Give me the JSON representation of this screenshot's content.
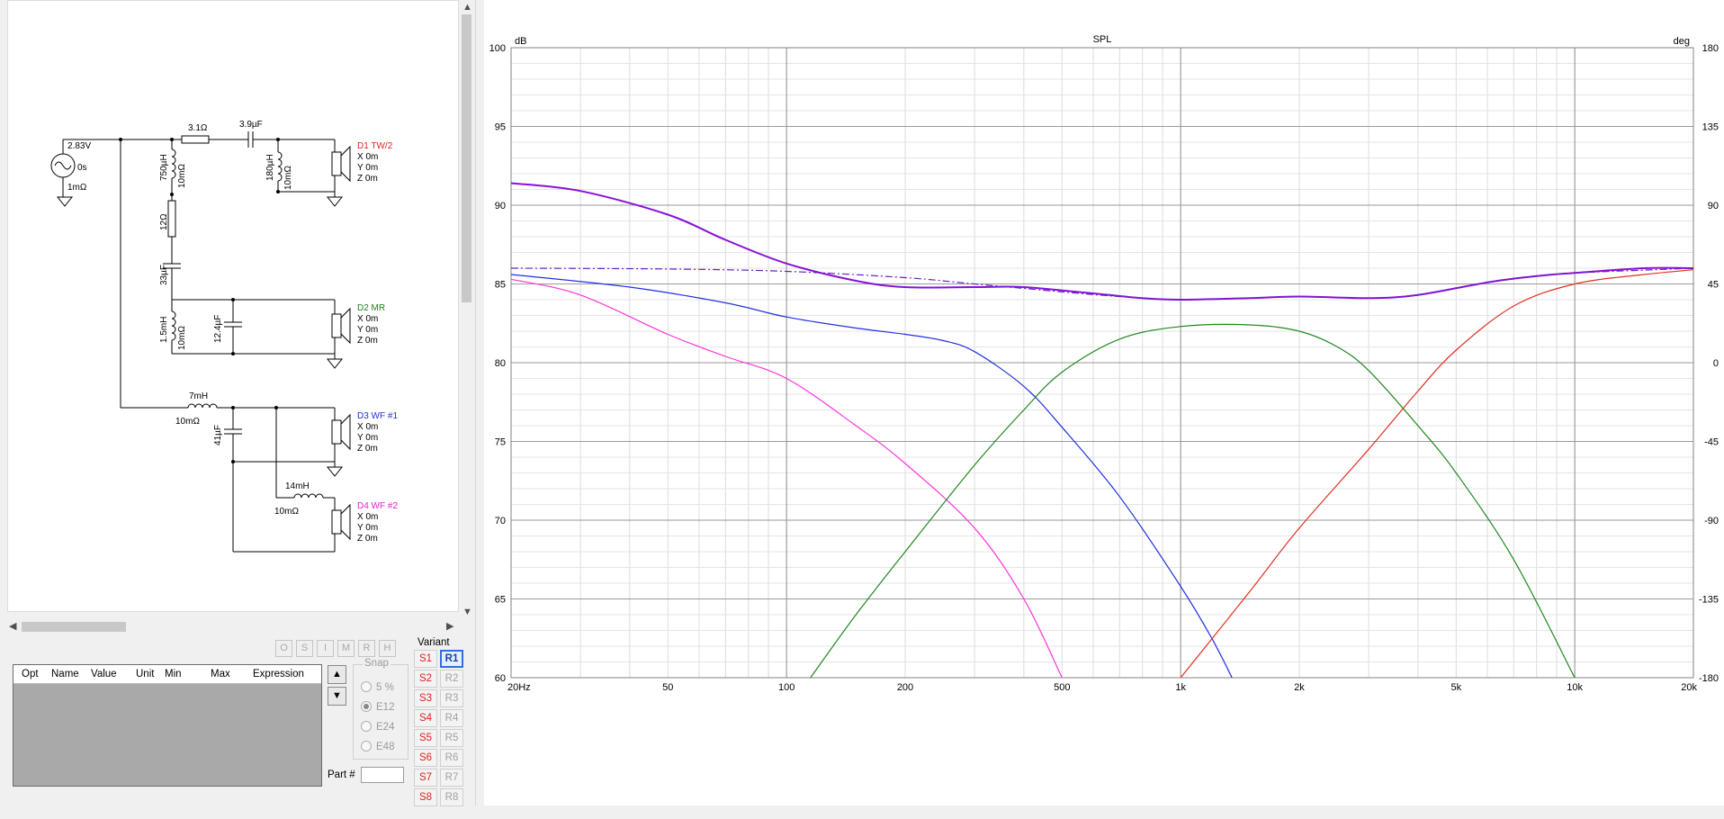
{
  "schematic": {
    "source": {
      "voltage": "2.83V",
      "delay": "0s",
      "resistance": "1mΩ"
    },
    "components": {
      "r_series_tw": "3.1Ω",
      "c_series_tw": "3.9µF",
      "l_shunt_main": "750µH",
      "l_shunt_main_r": "10mΩ",
      "l_shunt_tw": "180µH",
      "l_shunt_tw_r": "10mΩ",
      "r_mr": "12Ω",
      "c_mr": "33µF",
      "l_mr": "1.5mH",
      "l_mr_r": "10mΩ",
      "c_mr_shunt": "12.4µF",
      "l_wf1": "7mH",
      "l_wf1_r": "10mΩ",
      "c_wf1": "41µF",
      "l_wf2": "14mH",
      "l_wf2_r": "10mΩ"
    },
    "drivers": [
      {
        "name": "D1 TW/2",
        "color": "#e02020",
        "x": "X 0m",
        "y": "Y 0m",
        "z": "Z 0m"
      },
      {
        "name": "D2 MR",
        "color": "#208020",
        "x": "X 0m",
        "y": "Y 0m",
        "z": "Z 0m"
      },
      {
        "name": "D3 WF #1",
        "color": "#2030d0",
        "x": "X 0m",
        "y": "Y 0m",
        "z": "Z 0m"
      },
      {
        "name": "D4 WF #2",
        "color": "#e020d0",
        "x": "X 0m",
        "y": "Y 0m",
        "z": "Z 0m"
      }
    ]
  },
  "toolbar_buttons": [
    "O",
    "S",
    "I",
    "M",
    "R",
    "H"
  ],
  "param_table": {
    "columns": [
      "Opt",
      "Name",
      "Value",
      "Unit",
      "Min",
      "Max",
      "Expression"
    ]
  },
  "snap": {
    "title": "Snap",
    "options": [
      "5 %",
      "E12",
      "E24",
      "E48"
    ],
    "selected": "E12"
  },
  "part_label": "Part #",
  "variant": {
    "label": "Variant",
    "s_buttons": [
      "S1",
      "S2",
      "S3",
      "S4",
      "S5",
      "S6",
      "S7",
      "S8"
    ],
    "r_buttons": [
      "R1",
      "R2",
      "R3",
      "R4",
      "R5",
      "R6",
      "R7",
      "R8"
    ],
    "active": "R1"
  },
  "chart_data": {
    "type": "line",
    "title": "SPL",
    "ylabel": "dB",
    "y2label": "deg",
    "xscale": "log",
    "xlim": [
      20,
      20000
    ],
    "ylim": [
      60,
      100
    ],
    "y2lim": [
      -180,
      180
    ],
    "x_ticks": [
      {
        "v": 20,
        "label": "20Hz"
      },
      {
        "v": 50,
        "label": "50"
      },
      {
        "v": 100,
        "label": "100"
      },
      {
        "v": 200,
        "label": "200"
      },
      {
        "v": 500,
        "label": "500"
      },
      {
        "v": 1000,
        "label": "1k"
      },
      {
        "v": 2000,
        "label": "2k"
      },
      {
        "v": 5000,
        "label": "5k"
      },
      {
        "v": 10000,
        "label": "10k"
      },
      {
        "v": 20000,
        "label": "20k"
      }
    ],
    "y_ticks": [
      100,
      95,
      90,
      85,
      80,
      75,
      70,
      65,
      60
    ],
    "y2_ticks": [
      180,
      135,
      90,
      45,
      0,
      -45,
      -90,
      -135,
      -180
    ],
    "grid": true,
    "series": [
      {
        "color": "#8a10d8",
        "width": 2,
        "dash": "",
        "points": [
          [
            20,
            91.4
          ],
          [
            30,
            90.9
          ],
          [
            50,
            89.4
          ],
          [
            70,
            87.8
          ],
          [
            100,
            86.3
          ],
          [
            150,
            85.2
          ],
          [
            200,
            84.8
          ],
          [
            300,
            84.8
          ],
          [
            400,
            84.8
          ],
          [
            600,
            84.4
          ],
          [
            800,
            84.1
          ],
          [
            1000,
            84.0
          ],
          [
            1500,
            84.1
          ],
          [
            2000,
            84.2
          ],
          [
            3000,
            84.1
          ],
          [
            4000,
            84.3
          ],
          [
            6000,
            85.1
          ],
          [
            8000,
            85.5
          ],
          [
            10000,
            85.7
          ],
          [
            15000,
            86.0
          ],
          [
            20000,
            86.0
          ]
        ]
      },
      {
        "color": "#6a20c0",
        "width": 1.2,
        "dash": "8,3,2,3",
        "points": [
          [
            20,
            86.0
          ],
          [
            50,
            85.95
          ],
          [
            100,
            85.8
          ],
          [
            200,
            85.4
          ],
          [
            300,
            85.0
          ],
          [
            500,
            84.5
          ],
          [
            700,
            84.2
          ],
          [
            1000,
            84.0
          ],
          [
            1500,
            84.1
          ],
          [
            2000,
            84.2
          ],
          [
            3000,
            84.1
          ],
          [
            4000,
            84.3
          ],
          [
            6000,
            85.1
          ],
          [
            8000,
            85.5
          ],
          [
            10000,
            85.7
          ],
          [
            20000,
            86.0
          ]
        ]
      },
      {
        "color": "#2030e0",
        "width": 1.2,
        "dash": "",
        "points": [
          [
            20,
            85.6
          ],
          [
            40,
            84.8
          ],
          [
            70,
            83.8
          ],
          [
            100,
            82.9
          ],
          [
            150,
            82.2
          ],
          [
            200,
            81.8
          ],
          [
            250,
            81.4
          ],
          [
            300,
            80.7
          ],
          [
            400,
            78.5
          ],
          [
            500,
            75.9
          ],
          [
            700,
            71.5
          ],
          [
            1000,
            65.8
          ],
          [
            1200,
            62.5
          ],
          [
            1350,
            60.0
          ]
        ]
      },
      {
        "color": "#ff33dd",
        "width": 1.2,
        "dash": "",
        "points": [
          [
            20,
            85.3
          ],
          [
            30,
            84.3
          ],
          [
            50,
            81.8
          ],
          [
            70,
            80.4
          ],
          [
            100,
            79.0
          ],
          [
            150,
            76.0
          ],
          [
            200,
            73.6
          ],
          [
            300,
            69.5
          ],
          [
            400,
            65.0
          ],
          [
            500,
            60.0
          ]
        ]
      },
      {
        "color": "#208820",
        "width": 1.2,
        "dash": "",
        "points": [
          [
            115,
            60.0
          ],
          [
            150,
            64.0
          ],
          [
            200,
            68.0
          ],
          [
            300,
            73.5
          ],
          [
            400,
            77.0
          ],
          [
            500,
            79.4
          ],
          [
            700,
            81.5
          ],
          [
            1000,
            82.3
          ],
          [
            1500,
            82.4
          ],
          [
            2000,
            82.0
          ],
          [
            2500,
            81.0
          ],
          [
            3000,
            79.5
          ],
          [
            4000,
            76.0
          ],
          [
            5000,
            73.0
          ],
          [
            7000,
            67.5
          ],
          [
            10000,
            60.0
          ]
        ]
      },
      {
        "color": "#e03020",
        "width": 1.2,
        "dash": "",
        "points": [
          [
            1000,
            60.0
          ],
          [
            1500,
            65.5
          ],
          [
            2000,
            69.5
          ],
          [
            3000,
            74.5
          ],
          [
            4000,
            78.2
          ],
          [
            5000,
            80.8
          ],
          [
            7000,
            83.6
          ],
          [
            10000,
            85.0
          ],
          [
            15000,
            85.6
          ],
          [
            20000,
            85.9
          ]
        ]
      }
    ]
  }
}
